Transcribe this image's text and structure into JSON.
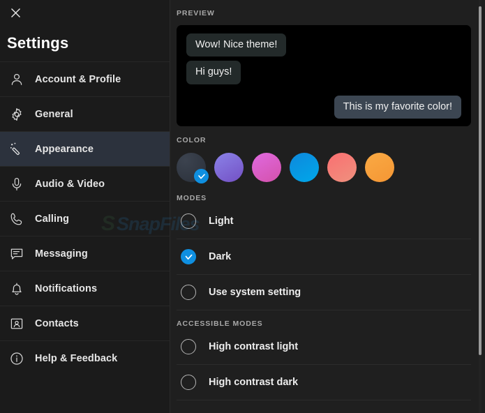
{
  "window": {
    "close_label": "×"
  },
  "sidebar": {
    "title": "Settings",
    "items": [
      {
        "label": "Account & Profile",
        "icon": "person-icon",
        "active": false
      },
      {
        "label": "General",
        "icon": "gear-icon",
        "active": false
      },
      {
        "label": "Appearance",
        "icon": "magic-wand-icon",
        "active": true
      },
      {
        "label": "Audio & Video",
        "icon": "microphone-icon",
        "active": false
      },
      {
        "label": "Calling",
        "icon": "phone-icon",
        "active": false
      },
      {
        "label": "Messaging",
        "icon": "chat-icon",
        "active": false
      },
      {
        "label": "Notifications",
        "icon": "bell-icon",
        "active": false
      },
      {
        "label": "Contacts",
        "icon": "contact-card-icon",
        "active": false
      },
      {
        "label": "Help & Feedback",
        "icon": "info-icon",
        "active": false
      }
    ]
  },
  "main": {
    "preview": {
      "heading": "PREVIEW",
      "messages": [
        {
          "text": "Wow! Nice theme!",
          "direction": "incoming"
        },
        {
          "text": "Hi guys!",
          "direction": "incoming"
        },
        {
          "text": "This is my favorite color!",
          "direction": "outgoing"
        }
      ]
    },
    "color": {
      "heading": "COLOR",
      "selected_index": 0,
      "swatches": [
        {
          "name": "slate",
          "from": "#39404c",
          "to": "#2b313c",
          "selected": true
        },
        {
          "name": "purple",
          "from": "#8279e0",
          "to": "#7350c4",
          "selected": false
        },
        {
          "name": "magenta",
          "from": "#dd5ed6",
          "to": "#d955b5",
          "selected": false
        },
        {
          "name": "blue",
          "from": "#0d8fdb",
          "to": "#00a6e8",
          "selected": false
        },
        {
          "name": "salmon",
          "from": "#f87272",
          "to": "#ef8d7c",
          "selected": false
        },
        {
          "name": "orange",
          "from": "#f9a63f",
          "to": "#f59c3c",
          "selected": false
        }
      ],
      "check_color": "#0f8fe0"
    },
    "modes": {
      "heading": "MODES",
      "options": [
        {
          "label": "Light",
          "selected": false
        },
        {
          "label": "Dark",
          "selected": true
        },
        {
          "label": "Use system setting",
          "selected": false
        }
      ]
    },
    "accessible_modes": {
      "heading": "ACCESSIBLE MODES",
      "options": [
        {
          "label": "High contrast light",
          "selected": false
        },
        {
          "label": "High contrast dark",
          "selected": false
        }
      ]
    }
  },
  "watermark": {
    "logo": "S",
    "text": "SnapFiles"
  }
}
